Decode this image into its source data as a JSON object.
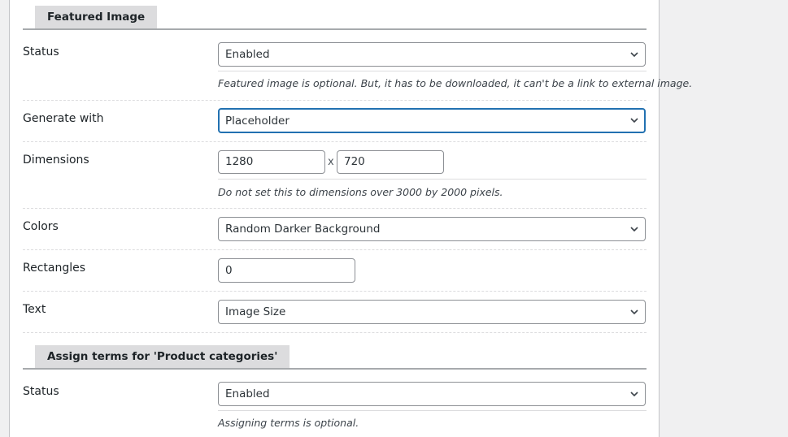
{
  "sections": [
    {
      "title": "Featured Image",
      "rows": [
        {
          "label": "Status",
          "value": "Enabled",
          "description": "Featured image is optional. But, it has to be downloaded, it can't be a link to external image."
        },
        {
          "label": "Generate with",
          "value": "Placeholder"
        },
        {
          "label": "Dimensions",
          "width": "1280",
          "separator": "x",
          "height": "720",
          "description": "Do not set this to dimensions over 3000 by 2000 pixels."
        },
        {
          "label": "Colors",
          "value": "Random Darker Background"
        },
        {
          "label": "Rectangles",
          "value": "0"
        },
        {
          "label": "Text",
          "value": "Image Size"
        }
      ]
    },
    {
      "title": "Assign terms for 'Product categories'",
      "rows": [
        {
          "label": "Status",
          "value": "Enabled",
          "description": "Assigning terms is optional."
        }
      ]
    }
  ],
  "colors": {
    "focus": "#2271b1",
    "tab_bg": "#dcdcde",
    "page_bg": "#f0f0f1"
  }
}
